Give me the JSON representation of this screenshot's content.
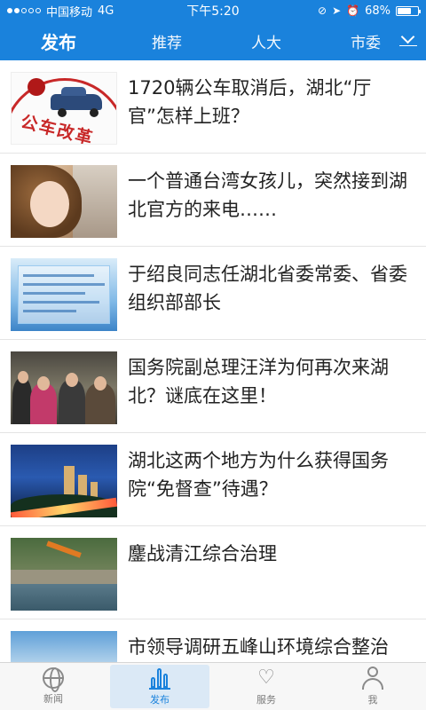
{
  "status_bar": {
    "carrier": "中国移动",
    "network": "4G",
    "time": "下午5:20",
    "battery_percent": "68%",
    "battery_level": 0.68
  },
  "nav": {
    "tabs": [
      "发布",
      "推荐",
      "人大",
      "市委"
    ],
    "active_index": 0,
    "more_icon": "chevron-down-icon"
  },
  "news": [
    {
      "title": "1720辆公车取消后，湖北“厅官”怎样上班？",
      "thumb_text": "公车改革"
    },
    {
      "title": "一个普通台湾女孩儿，突然接到湖北官方的来电……"
    },
    {
      "title": "于绍良同志任湖北省委常委、省委组织部部长"
    },
    {
      "title": "国务院副总理汪洋为何再次来湖北？谜底在这里！"
    },
    {
      "title": "湖北这两个地方为什么获得国务院“免督查”待遇？"
    },
    {
      "title": "鏖战清江综合治理"
    },
    {
      "title": "市领导调研五峰山环境综合整治"
    }
  ],
  "tab_bar": {
    "tabs": [
      {
        "label": "新闻",
        "icon": "globe-icon"
      },
      {
        "label": "发布",
        "icon": "bar-chart-icon"
      },
      {
        "label": "服务",
        "icon": "heart-icon"
      },
      {
        "label": "我",
        "icon": "person-icon"
      }
    ],
    "active_index": 1
  },
  "colors": {
    "header": "#1a82dc",
    "active_tab": "#1a82dc",
    "active_tab_bg": "#dbe9f6",
    "title_text": "#222222"
  }
}
